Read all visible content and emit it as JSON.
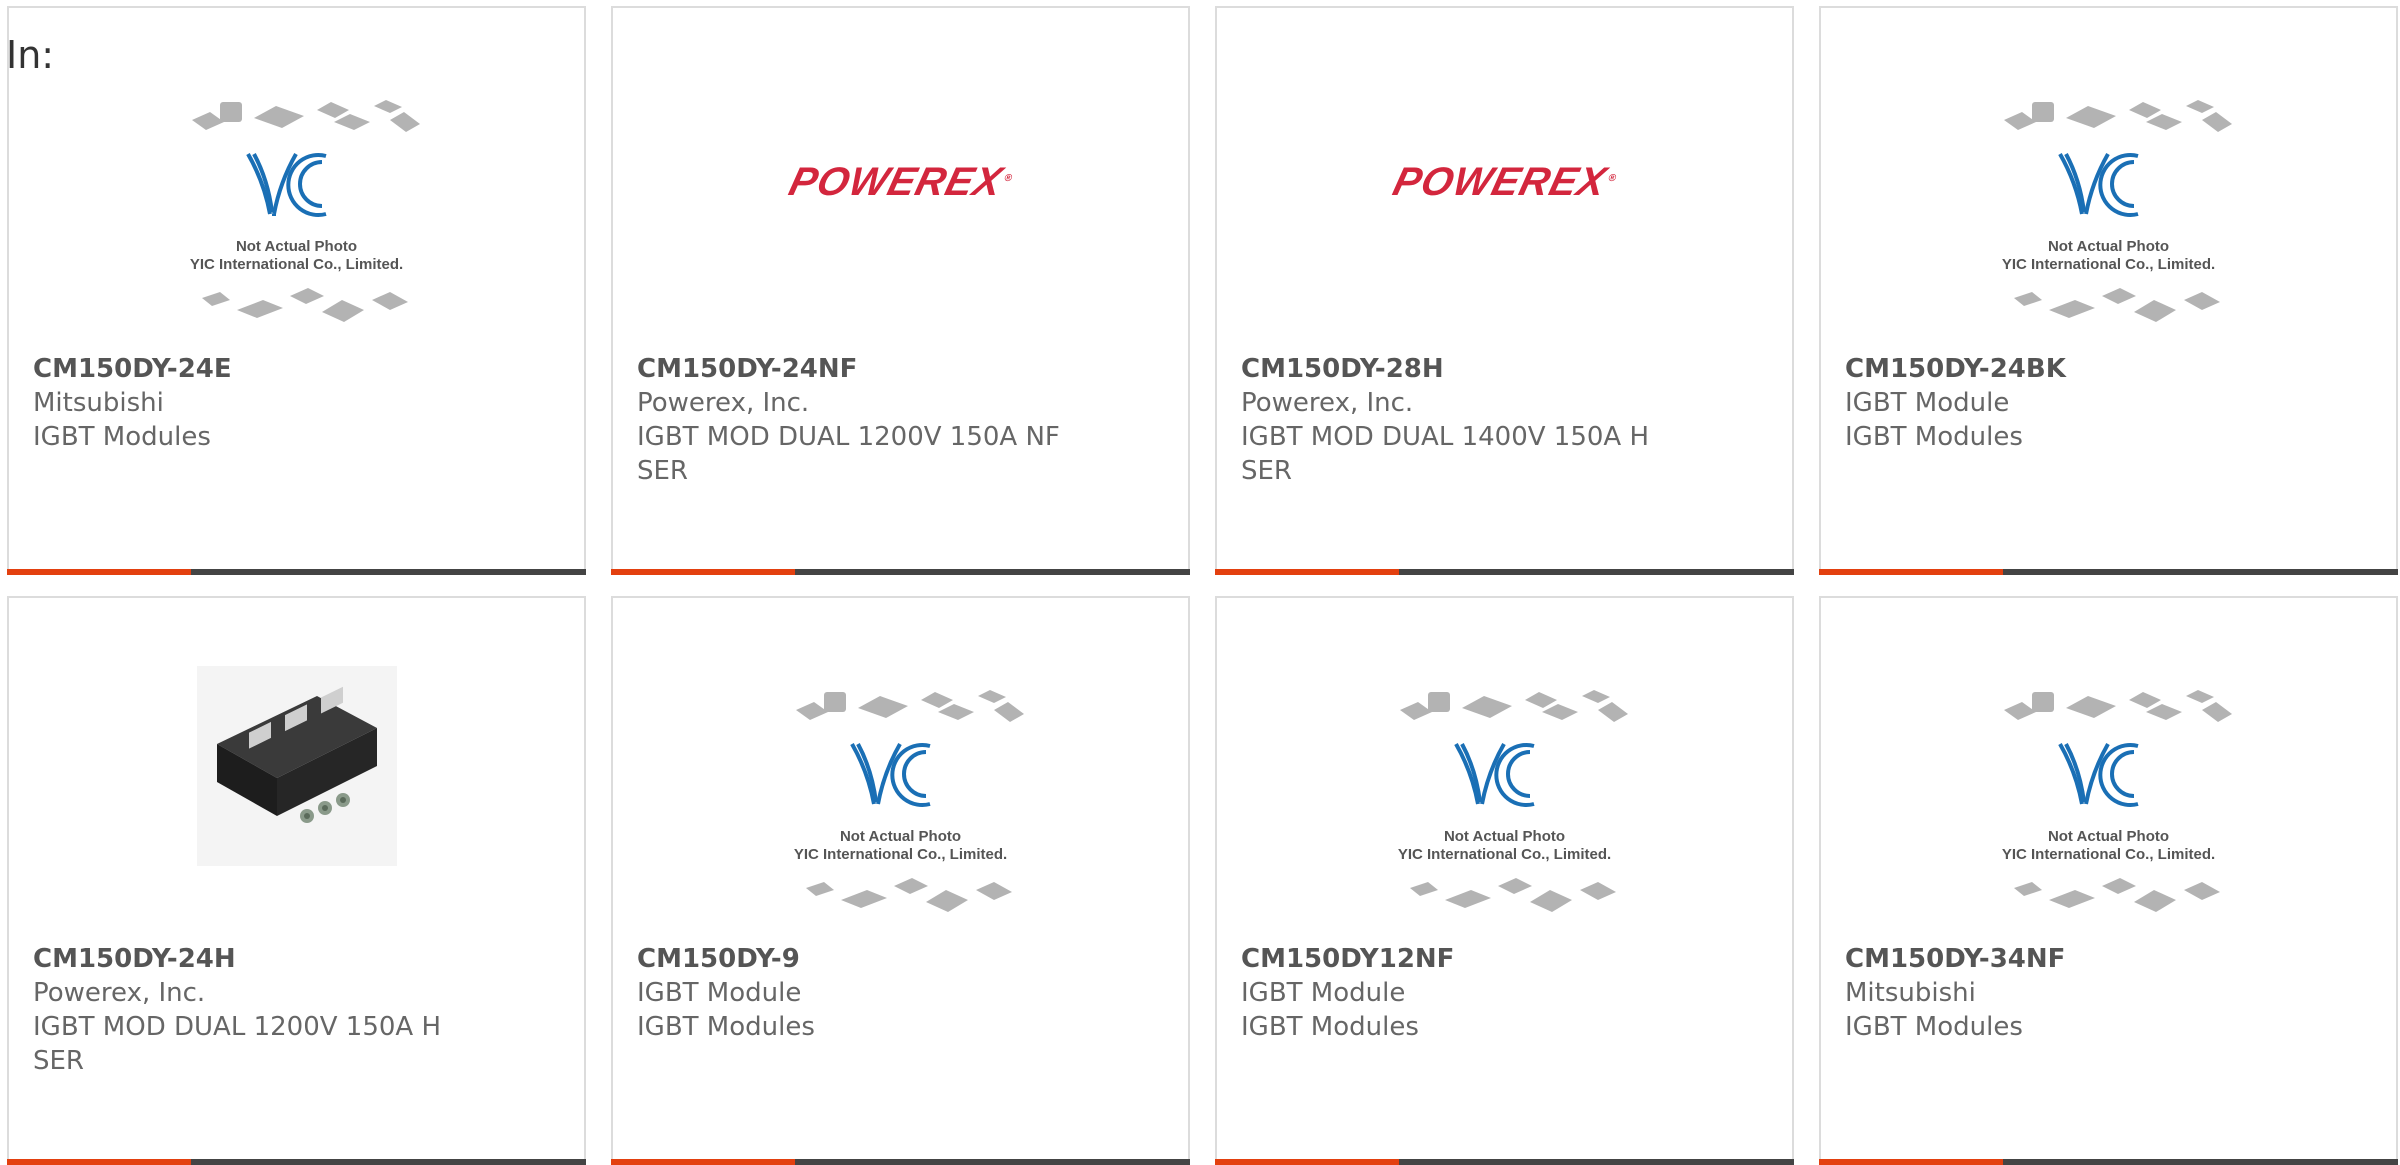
{
  "page": {
    "label": "In:"
  },
  "placeholder": {
    "line1": "Not Actual Photo",
    "line2": "YIC International Co., Limited.",
    "brand": "YIC"
  },
  "powerex_logo": {
    "text": "POWEREX",
    "mark": "®"
  },
  "colors": {
    "accent": "#e3400f",
    "bar": "#444444",
    "powerex": "#d3263d",
    "yic": "#1a6fb5"
  },
  "products": [
    {
      "part": "CM150DY-24E",
      "maker": "Mitsubishi",
      "desc": "IGBT Modules",
      "image": "yic-placeholder"
    },
    {
      "part": "CM150DY-24NF",
      "maker": "Powerex, Inc.",
      "desc": "IGBT MOD DUAL 1200V 150A NF SER",
      "image": "powerex-logo"
    },
    {
      "part": "CM150DY-28H",
      "maker": "Powerex, Inc.",
      "desc": "IGBT MOD DUAL 1400V 150A H SER",
      "image": "powerex-logo"
    },
    {
      "part": "CM150DY-24BK",
      "maker": "IGBT Module",
      "desc": "IGBT Modules",
      "image": "yic-placeholder"
    },
    {
      "part": "CM150DY-24H",
      "maker": "Powerex, Inc.",
      "desc": "IGBT MOD DUAL 1200V 150A H SER",
      "image": "module-photo"
    },
    {
      "part": "CM150DY-9",
      "maker": "IGBT Module",
      "desc": "IGBT Modules",
      "image": "yic-placeholder"
    },
    {
      "part": "CM150DY12NF",
      "maker": "IGBT Module",
      "desc": "IGBT Modules",
      "image": "yic-placeholder"
    },
    {
      "part": "CM150DY-34NF",
      "maker": "Mitsubishi",
      "desc": "IGBT Modules",
      "image": "yic-placeholder"
    }
  ]
}
